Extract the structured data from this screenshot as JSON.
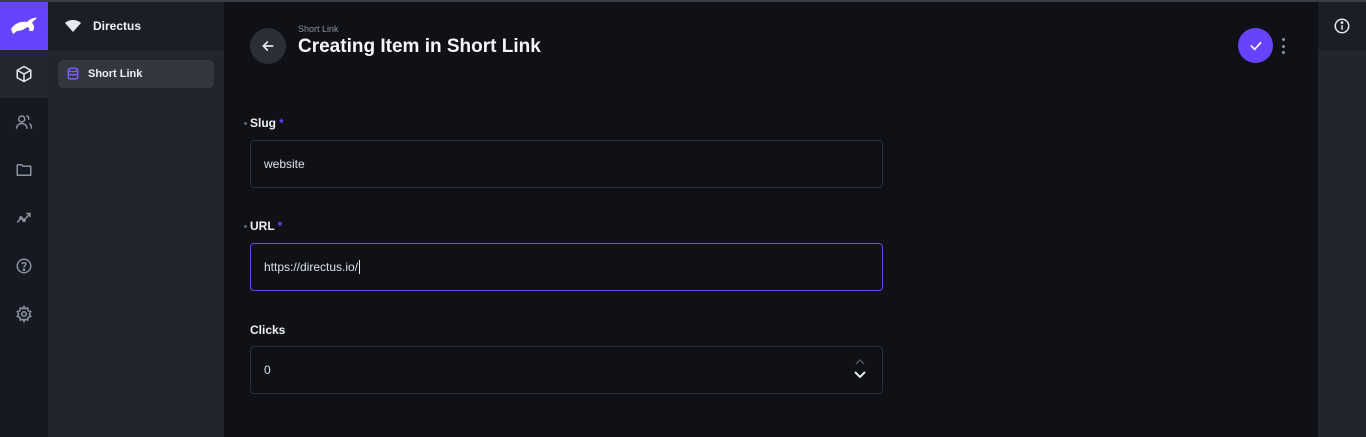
{
  "project": {
    "name": "Directus"
  },
  "navigation": {
    "items": [
      {
        "label": "Short Link"
      }
    ]
  },
  "header": {
    "breadcrumb": "Short Link",
    "title": "Creating Item in Short Link"
  },
  "fields": {
    "slug": {
      "label": "Slug",
      "required_marker": "*",
      "value": "website"
    },
    "url": {
      "label": "URL",
      "required_marker": "*",
      "value": "https://directus.io/"
    },
    "clicks": {
      "label": "Clicks",
      "value": "0"
    }
  },
  "icons": {
    "logo": "directus-rabbit-icon",
    "rail": [
      "content-box-icon",
      "users-icon",
      "folder-icon",
      "insights-icon",
      "help-icon",
      "settings-icon"
    ],
    "back": "arrow-left-icon",
    "save": "check-icon",
    "more": "more-vertical-icon",
    "info": "info-icon"
  },
  "colors": {
    "accent": "#6644ff",
    "background": "#0f1117",
    "panel": "#21252d"
  }
}
